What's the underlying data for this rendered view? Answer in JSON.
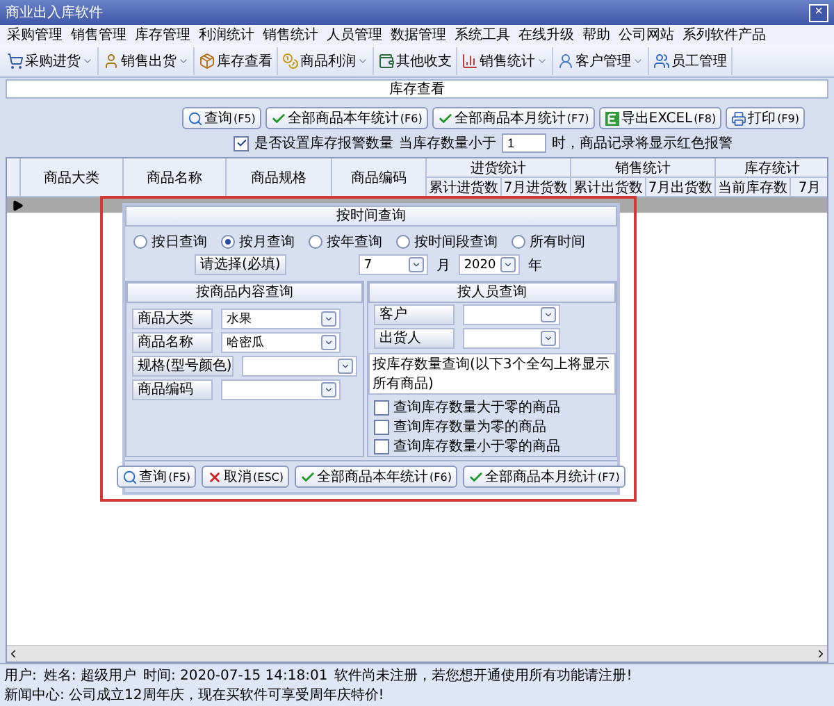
{
  "window": {
    "title": "商业出入库软件",
    "close": "×"
  },
  "menu": [
    "采购管理",
    "销售管理",
    "库存管理",
    "利润统计",
    "销售统计",
    "人员管理",
    "数据管理",
    "系统工具",
    "在线升级",
    "帮助",
    "公司网站",
    "系列软件产品"
  ],
  "toolbar": [
    {
      "label": "采购进货",
      "dropdown": true
    },
    {
      "label": "销售出货",
      "dropdown": true
    },
    {
      "label": "库存查看",
      "dropdown": false
    },
    {
      "label": "商品利润",
      "dropdown": true
    },
    {
      "label": "其他收支",
      "dropdown": false
    },
    {
      "label": "销售统计",
      "dropdown": true
    },
    {
      "label": "客户管理",
      "dropdown": true
    },
    {
      "label": "员工管理",
      "dropdown": false
    }
  ],
  "panel_title": "库存查看",
  "actions": [
    {
      "label": "查询",
      "key": "(F5)"
    },
    {
      "label": "全部商品本年统计",
      "key": "(F6)"
    },
    {
      "label": "全部商品本月统计",
      "key": "(F7)"
    },
    {
      "label": "导出EXCEL",
      "key": "(F8)"
    },
    {
      "label": "打印",
      "key": "(F9)"
    }
  ],
  "alarm": {
    "checked": true,
    "label": "是否设置库存报警数量",
    "threshold_label": "当库存数量小于",
    "value": "1",
    "suffix": "时，商品记录将显示红色报警"
  },
  "table": {
    "columns": [
      "商品大类",
      "商品名称",
      "商品规格",
      "商品编码"
    ],
    "groups": [
      {
        "title": "进货统计",
        "columns": [
          "累计进货数",
          "7月进货数"
        ]
      },
      {
        "title": "销售统计",
        "columns": [
          "累计出货数",
          "7月出货数"
        ]
      },
      {
        "title": "库存统计",
        "columns": [
          "当前库存数",
          "7月"
        ]
      }
    ]
  },
  "dialog": {
    "title": "按时间查询",
    "time_modes": [
      {
        "label": "按日查询",
        "selected": false
      },
      {
        "label": "按月查询",
        "selected": true
      },
      {
        "label": "按年查询",
        "selected": false
      },
      {
        "label": "按时间段查询",
        "selected": false
      },
      {
        "label": "所有时间",
        "selected": false
      }
    ],
    "select_label": "请选择(必填)",
    "month": "7",
    "month_unit": "月",
    "year": "2020",
    "year_unit": "年",
    "product_title": "按商品内容查询",
    "product_fields": [
      {
        "label": "商品大类",
        "value": "水果"
      },
      {
        "label": "商品名称",
        "value": "哈密瓜"
      },
      {
        "label": "规格(型号颜色)"
      },
      {
        "label": "商品编码"
      }
    ],
    "people_title": "按人员查询",
    "people_fields": [
      {
        "label": "客户"
      },
      {
        "label": "出货人"
      }
    ],
    "stock_title": "按库存数量查询(以下3个全勾上将显示所有商品)",
    "stock_options": [
      {
        "label": "查询库存数量大于零的商品",
        "checked": false
      },
      {
        "label": "查询库存数量为零的商品",
        "checked": false
      },
      {
        "label": "查询库存数量小于零的商品",
        "checked": false
      }
    ],
    "buttons": [
      {
        "label": "查询",
        "key": "(F5)"
      },
      {
        "label": "取消",
        "key": "(ESC)"
      },
      {
        "label": "全部商品本年统计",
        "key": "(F6)"
      },
      {
        "label": "全部商品本月统计",
        "key": "(F7)"
      }
    ]
  },
  "status": [
    "用户:",
    "姓名: 超级用户",
    "时间: 2020-07-15 14:18:01",
    "软件尚未注册，若您想开通使用所有功能请注册!",
    "新闻中心: 公司成立12周年庆，现在买软件可享受周年庆特价!"
  ]
}
